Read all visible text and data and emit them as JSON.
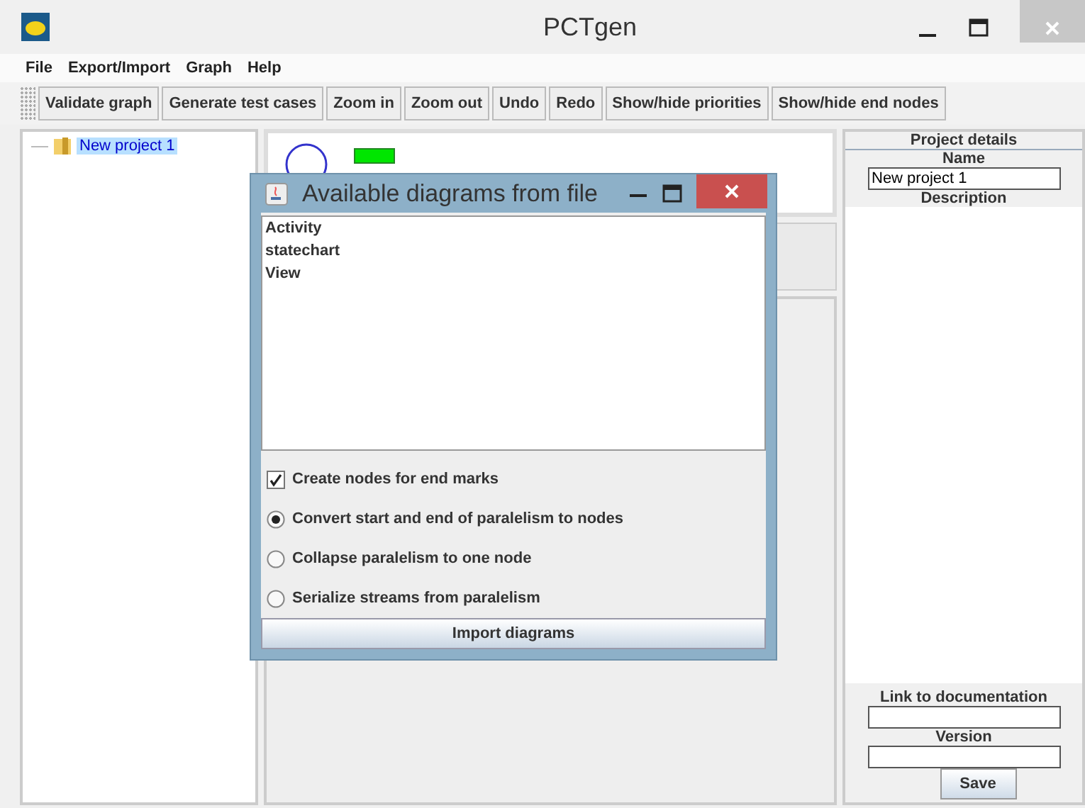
{
  "window": {
    "title": "PCTgen"
  },
  "menu": [
    "File",
    "Export/Import",
    "Graph",
    "Help"
  ],
  "toolbar": [
    "Validate graph",
    "Generate test cases",
    "Zoom in",
    "Zoom out",
    "Undo",
    "Redo",
    "Show/hide priorities",
    "Show/hide end nodes"
  ],
  "tree": {
    "items": [
      {
        "label": "New project 1",
        "selected": true
      }
    ]
  },
  "project_details": {
    "title": "Project details",
    "name_label": "Name",
    "name_value": "New project 1",
    "description_label": "Description",
    "link_label": "Link to documentation",
    "version_label": "Version",
    "save": "Save"
  },
  "dialog": {
    "title": "Available diagrams from file",
    "diagrams": [
      "Activity",
      "statechart",
      "View"
    ],
    "options": [
      {
        "kind": "checkbox",
        "label": "Create nodes for end marks",
        "checked": true
      },
      {
        "kind": "radio",
        "label": "Convert start and end of paralelism to nodes",
        "selected": true
      },
      {
        "kind": "radio",
        "label": "Collapse paralelism to one node",
        "selected": false
      },
      {
        "kind": "radio",
        "label": "Serialize streams from paralelism",
        "selected": false
      }
    ],
    "button": "Import diagrams"
  }
}
